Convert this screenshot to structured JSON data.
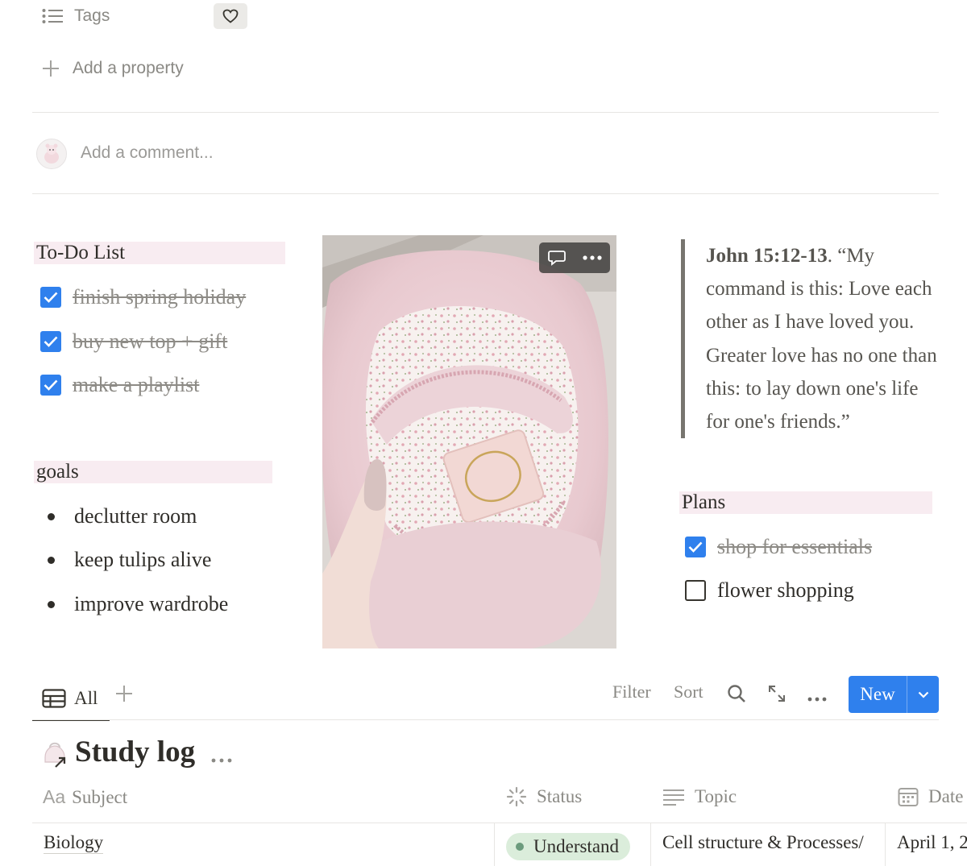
{
  "properties": {
    "tags_label": "Tags",
    "add_property_label": "Add a property"
  },
  "comment": {
    "placeholder": "Add a comment..."
  },
  "todo_list": {
    "heading": "To-Do List",
    "items": [
      {
        "label": "finish spring holiday",
        "checked": true
      },
      {
        "label": "buy new top + gift",
        "checked": true
      },
      {
        "label": "make a playlist",
        "checked": true
      }
    ]
  },
  "goals": {
    "heading": "goals",
    "items": [
      "declutter room",
      "keep tulips alive",
      "improve wardrobe"
    ]
  },
  "quote": {
    "reference": "John 15:12-13",
    "text": ". “My command is this: Love each other as I have loved you. Greater love has no one than this: to lay down one's life for one's friends.”"
  },
  "plans": {
    "heading": "Plans",
    "items": [
      {
        "label": "shop for essentials",
        "checked": true
      },
      {
        "label": "flower shopping",
        "checked": false
      }
    ]
  },
  "view_toolbar": {
    "tab_all": "All",
    "filter": "Filter",
    "sort": "Sort",
    "new_button": "New"
  },
  "database": {
    "title": "Study log",
    "columns": [
      "Subject",
      "Status",
      "Topic",
      "Date"
    ],
    "rows": [
      {
        "subject": "Biology",
        "status": "Understand",
        "topic": "Cell structure & Processes/",
        "date": "April 1, 2"
      }
    ]
  },
  "colors": {
    "accent_blue": "#2f80ed",
    "heading_highlight": "#f8ecf1",
    "status_green_bg": "#dbeddb",
    "status_green_dot": "#6c9b7d"
  }
}
